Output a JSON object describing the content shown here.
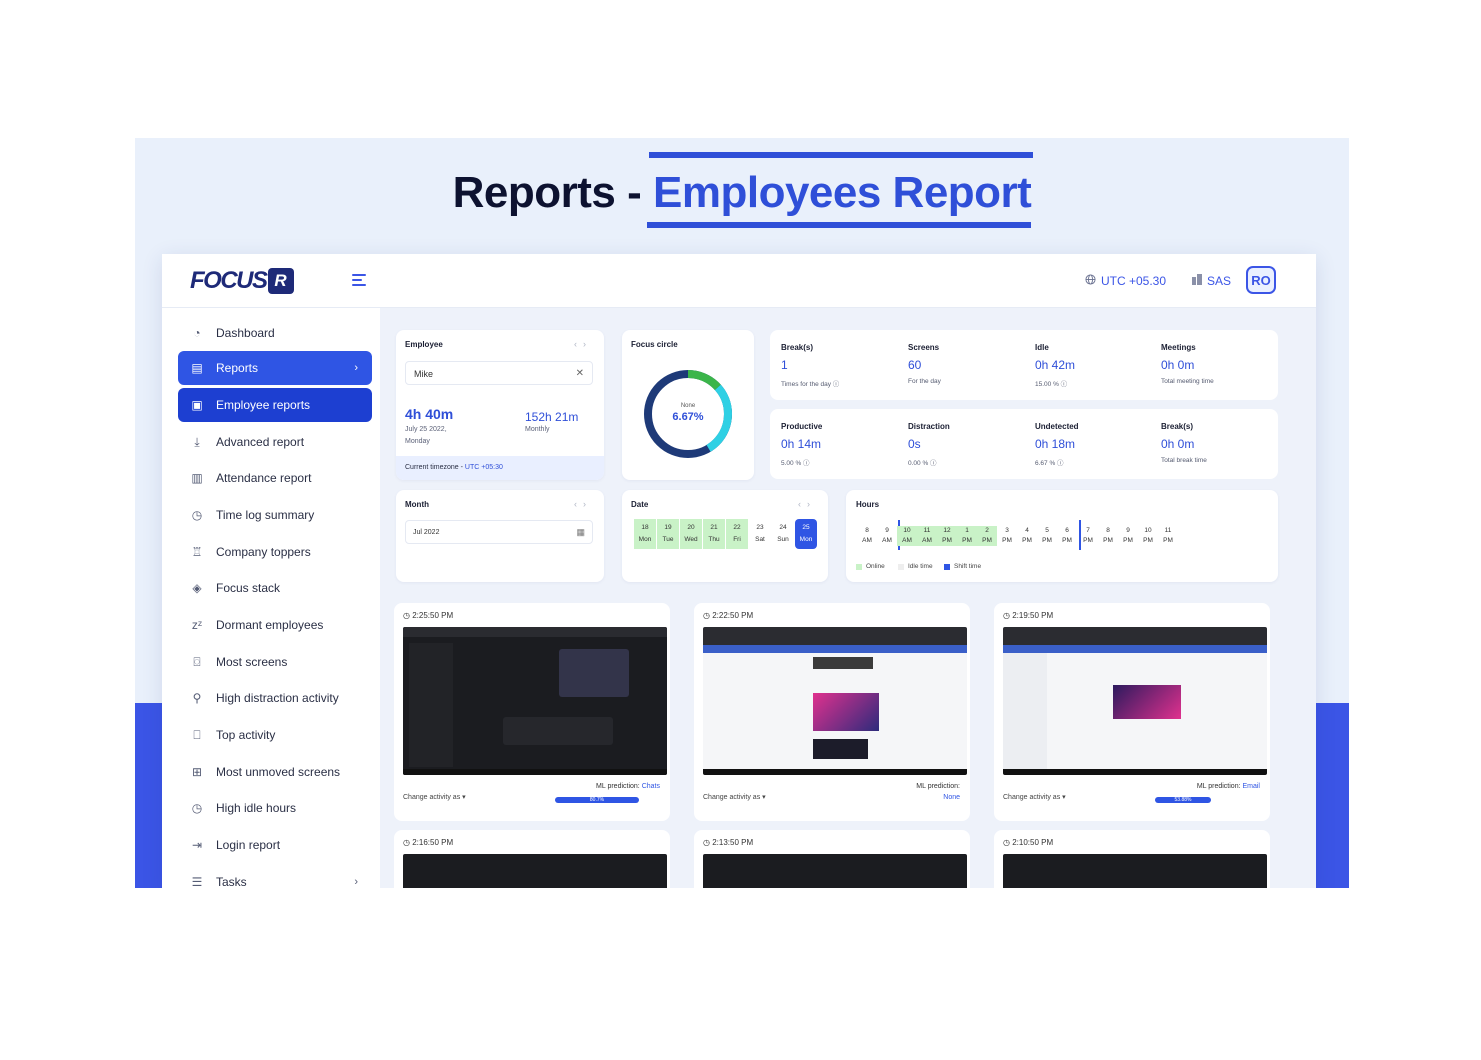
{
  "headline": {
    "prefix": "Reports - ",
    "accent": "Employees Report"
  },
  "topbar": {
    "logo_text": "FOCUS",
    "logo_badge": "R",
    "timezone": "UTC +05.30",
    "org": "SAS",
    "avatar": "RO"
  },
  "sidebar": {
    "items": [
      {
        "label": "Dashboard"
      },
      {
        "label": "Reports"
      },
      {
        "label": "Employee reports"
      },
      {
        "label": "Advanced report"
      },
      {
        "label": "Attendance report"
      },
      {
        "label": "Time log summary"
      },
      {
        "label": "Company toppers"
      },
      {
        "label": "Focus stack"
      },
      {
        "label": "Dormant employees"
      },
      {
        "label": "Most screens"
      },
      {
        "label": "High distraction activity"
      },
      {
        "label": "Top activity"
      },
      {
        "label": "Most unmoved screens"
      },
      {
        "label": "High idle hours"
      },
      {
        "label": "Login report"
      },
      {
        "label": "Tasks"
      }
    ]
  },
  "employee": {
    "label": "Employee",
    "selected": "Mike",
    "day_total": "4h 40m",
    "date": "July 25 2022,",
    "weekday": "Monday",
    "month_total": "152h 21m",
    "month_label": "Monthly",
    "timezone_label": "Current timezone - ",
    "timezone_value": "UTC +05:30"
  },
  "focus": {
    "label": "Focus circle",
    "center_label": "None",
    "center_value": "6.67%",
    "percent": 6.67
  },
  "stats_top": [
    {
      "label": "Break(s)",
      "value": "1",
      "sub": "Times for the day"
    },
    {
      "label": "Screens",
      "value": "60",
      "sub": "For the day"
    },
    {
      "label": "Idle",
      "value": "0h 42m",
      "sub": "15.00 %"
    },
    {
      "label": "Meetings",
      "value": "0h 0m",
      "sub": "Total meeting time"
    }
  ],
  "stats_bottom": [
    {
      "label": "Productive",
      "value": "0h 14m",
      "sub": "5.00 %"
    },
    {
      "label": "Distraction",
      "value": "0s",
      "sub": "0.00 %"
    },
    {
      "label": "Undetected",
      "value": "0h 18m",
      "sub": "6.67 %"
    },
    {
      "label": "Break(s)",
      "value": "0h 0m",
      "sub": "Total break time"
    }
  ],
  "month": {
    "label": "Month",
    "value": "Jul 2022"
  },
  "dates": {
    "label": "Date",
    "days": [
      {
        "num": "18",
        "name": "Mon"
      },
      {
        "num": "19",
        "name": "Tue"
      },
      {
        "num": "20",
        "name": "Wed"
      },
      {
        "num": "21",
        "name": "Thu"
      },
      {
        "num": "22",
        "name": "Fri"
      },
      {
        "num": "23",
        "name": "Sat"
      },
      {
        "num": "24",
        "name": "Sun"
      },
      {
        "num": "25",
        "name": "Mon"
      }
    ]
  },
  "hours": {
    "label": "Hours",
    "ticks": [
      {
        "h": "8",
        "p": "AM"
      },
      {
        "h": "9",
        "p": "AM"
      },
      {
        "h": "10",
        "p": "AM"
      },
      {
        "h": "11",
        "p": "AM"
      },
      {
        "h": "12",
        "p": "PM"
      },
      {
        "h": "1",
        "p": "PM"
      },
      {
        "h": "2",
        "p": "PM"
      },
      {
        "h": "3",
        "p": "PM"
      },
      {
        "h": "4",
        "p": "PM"
      },
      {
        "h": "5",
        "p": "PM"
      },
      {
        "h": "6",
        "p": "PM"
      },
      {
        "h": "7",
        "p": "PM"
      },
      {
        "h": "8",
        "p": "PM"
      },
      {
        "h": "9",
        "p": "PM"
      },
      {
        "h": "10",
        "p": "PM"
      },
      {
        "h": "11",
        "p": "PM"
      }
    ],
    "legend": [
      "Online",
      "Idle time",
      "Shift time"
    ]
  },
  "screenshots": [
    {
      "time": "2:25:50 PM",
      "change": "Change activity as",
      "ml_label": "ML prediction: ",
      "ml_value": "Chats",
      "bar": "80.7%"
    },
    {
      "time": "2:22:50 PM",
      "change": "Change activity as",
      "ml_label": "ML prediction:",
      "ml_value": "None",
      "bar": ""
    },
    {
      "time": "2:19:50 PM",
      "change": "Change activity as",
      "ml_label": "ML prediction: ",
      "ml_value": "Email",
      "bar": "53.88%"
    },
    {
      "time": "2:16:50 PM"
    },
    {
      "time": "2:13:50 PM"
    },
    {
      "time": "2:10:50 PM"
    }
  ],
  "colors": {
    "primary": "#2f55e4",
    "accent_green": "#c9f2c7",
    "donut_teal": "#2fd0e4",
    "donut_navy": "#1e3a78",
    "donut_green": "#3bb54a"
  }
}
